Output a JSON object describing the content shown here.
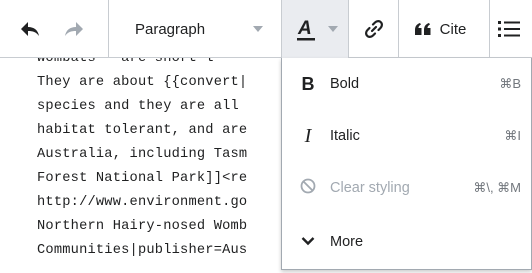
{
  "toolbar": {
    "paragraph_label": "Paragraph",
    "cite_label": "Cite"
  },
  "editor": {
    "lines": [
      "wombats   are short-l",
      "They are about {{convert|",
      "species and they are all",
      "habitat tolerant, and are",
      "Australia, including Tasm",
      "Forest National Park]]<re",
      "http://www.environment.go",
      "Northern Hairy-nosed Womb",
      "Communities|publisher=Aus"
    ]
  },
  "menu": {
    "items": [
      {
        "label": "Bold",
        "shortcut": "⌘B",
        "icon": "B"
      },
      {
        "label": "Italic",
        "shortcut": "⌘I",
        "icon": "I"
      },
      {
        "label": "Clear styling",
        "shortcut": "⌘\\, ⌘M"
      },
      {
        "label": "More"
      }
    ]
  },
  "colors": {
    "text": "#202122",
    "border": "#c8ccd1",
    "active_bg": "#eaecf0",
    "disabled": "#a2a9b1"
  }
}
